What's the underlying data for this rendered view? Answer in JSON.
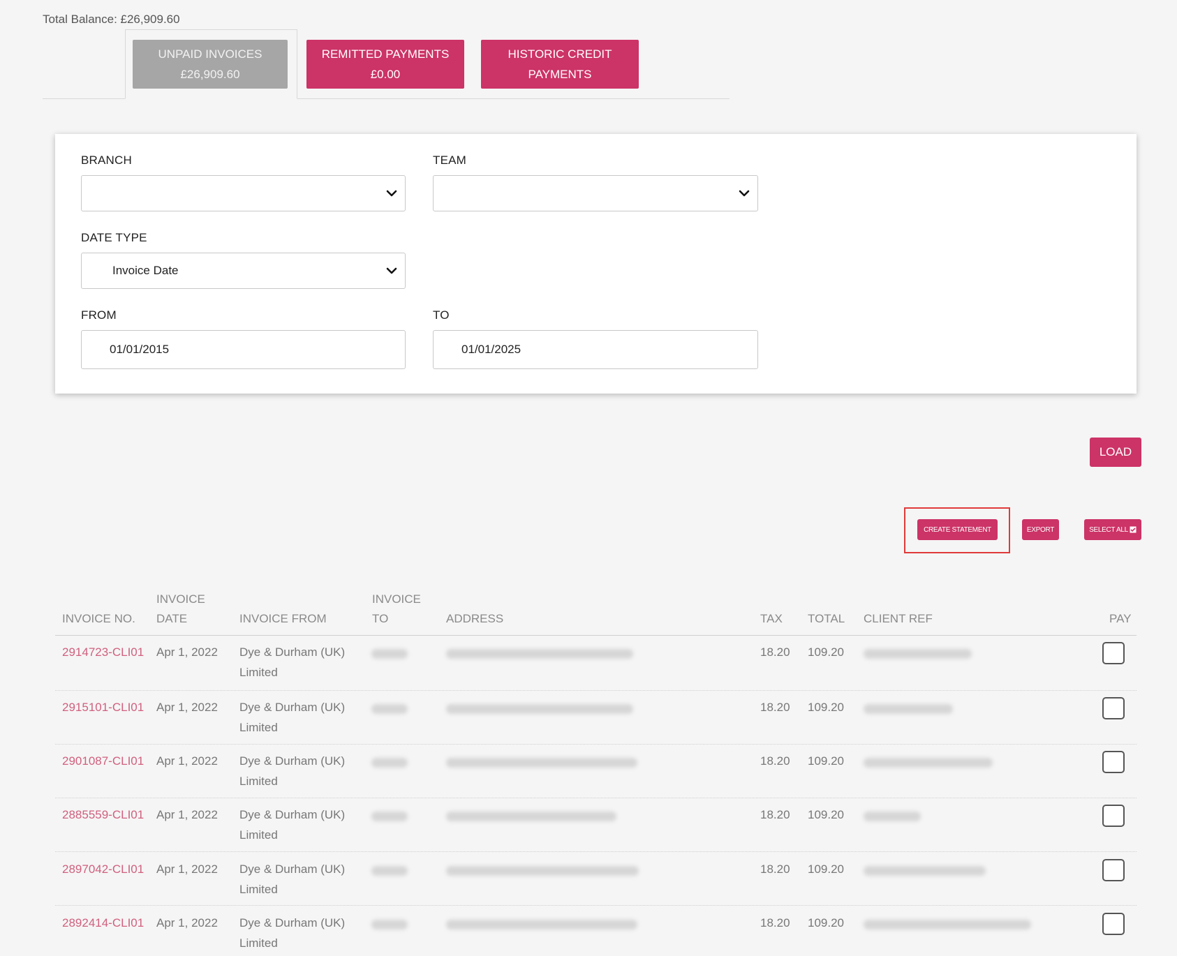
{
  "total_balance": "Total Balance: £26,909.60",
  "tabs": [
    {
      "line1": "UNPAID INVOICES",
      "line2": "£26,909.60",
      "active": true
    },
    {
      "line1": "REMITTED PAYMENTS",
      "line2": "£0.00"
    },
    {
      "line1": "HISTORIC CREDIT",
      "line2": "PAYMENTS"
    }
  ],
  "filters": {
    "branch_label": "BRANCH",
    "branch_value": "",
    "team_label": "TEAM",
    "team_value": "",
    "date_type_label": "DATE TYPE",
    "date_type_value": "Invoice Date",
    "from_label": "FROM",
    "from_value": "01/01/2015",
    "to_label": "TO",
    "to_value": "01/01/2025"
  },
  "actions": {
    "load": "LOAD",
    "create_statement": "CREATE STATEMENT",
    "export": "EXPORT",
    "select_all": "SELECT ALL"
  },
  "table": {
    "headers": {
      "invoice_no": "INVOICE NO.",
      "invoice_date_1": "INVOICE",
      "invoice_date_2": "DATE",
      "invoice_from": "INVOICE FROM",
      "invoice_to_1": "INVOICE",
      "invoice_to_2": "TO",
      "address": "ADDRESS",
      "tax": "TAX",
      "total": "TOTAL",
      "client_ref": "CLIENT REF",
      "pay": "PAY"
    },
    "rows": [
      {
        "invoice_no": "2914723-CLI01",
        "date": "Apr 1, 2022",
        "from_1": "Dye & Durham (UK)",
        "from_2": "Limited",
        "tax": "18.20",
        "total": "109.20"
      },
      {
        "invoice_no": "2915101-CLI01",
        "date": "Apr 1, 2022",
        "from_1": "Dye & Durham (UK)",
        "from_2": "Limited",
        "tax": "18.20",
        "total": "109.20"
      },
      {
        "invoice_no": "2901087-CLI01",
        "date": "Apr 1, 2022",
        "from_1": "Dye & Durham (UK)",
        "from_2": "Limited",
        "tax": "18.20",
        "total": "109.20"
      },
      {
        "invoice_no": "2885559-CLI01",
        "date": "Apr 1, 2022",
        "from_1": "Dye & Durham (UK)",
        "from_2": "Limited",
        "tax": "18.20",
        "total": "109.20"
      },
      {
        "invoice_no": "2897042-CLI01",
        "date": "Apr 1, 2022",
        "from_1": "Dye & Durham (UK)",
        "from_2": "Limited",
        "tax": "18.20",
        "total": "109.20"
      },
      {
        "invoice_no": "2892414-CLI01",
        "date": "Apr 1, 2022",
        "from_1": "Dye & Durham (UK)",
        "from_2": "Limited",
        "tax": "18.20",
        "total": "109.20"
      }
    ]
  },
  "colors": {
    "accent": "#cc3366",
    "tab_inactive": "#a6a6a6",
    "link": "#d0607e",
    "highlight": "#e03a3a"
  }
}
